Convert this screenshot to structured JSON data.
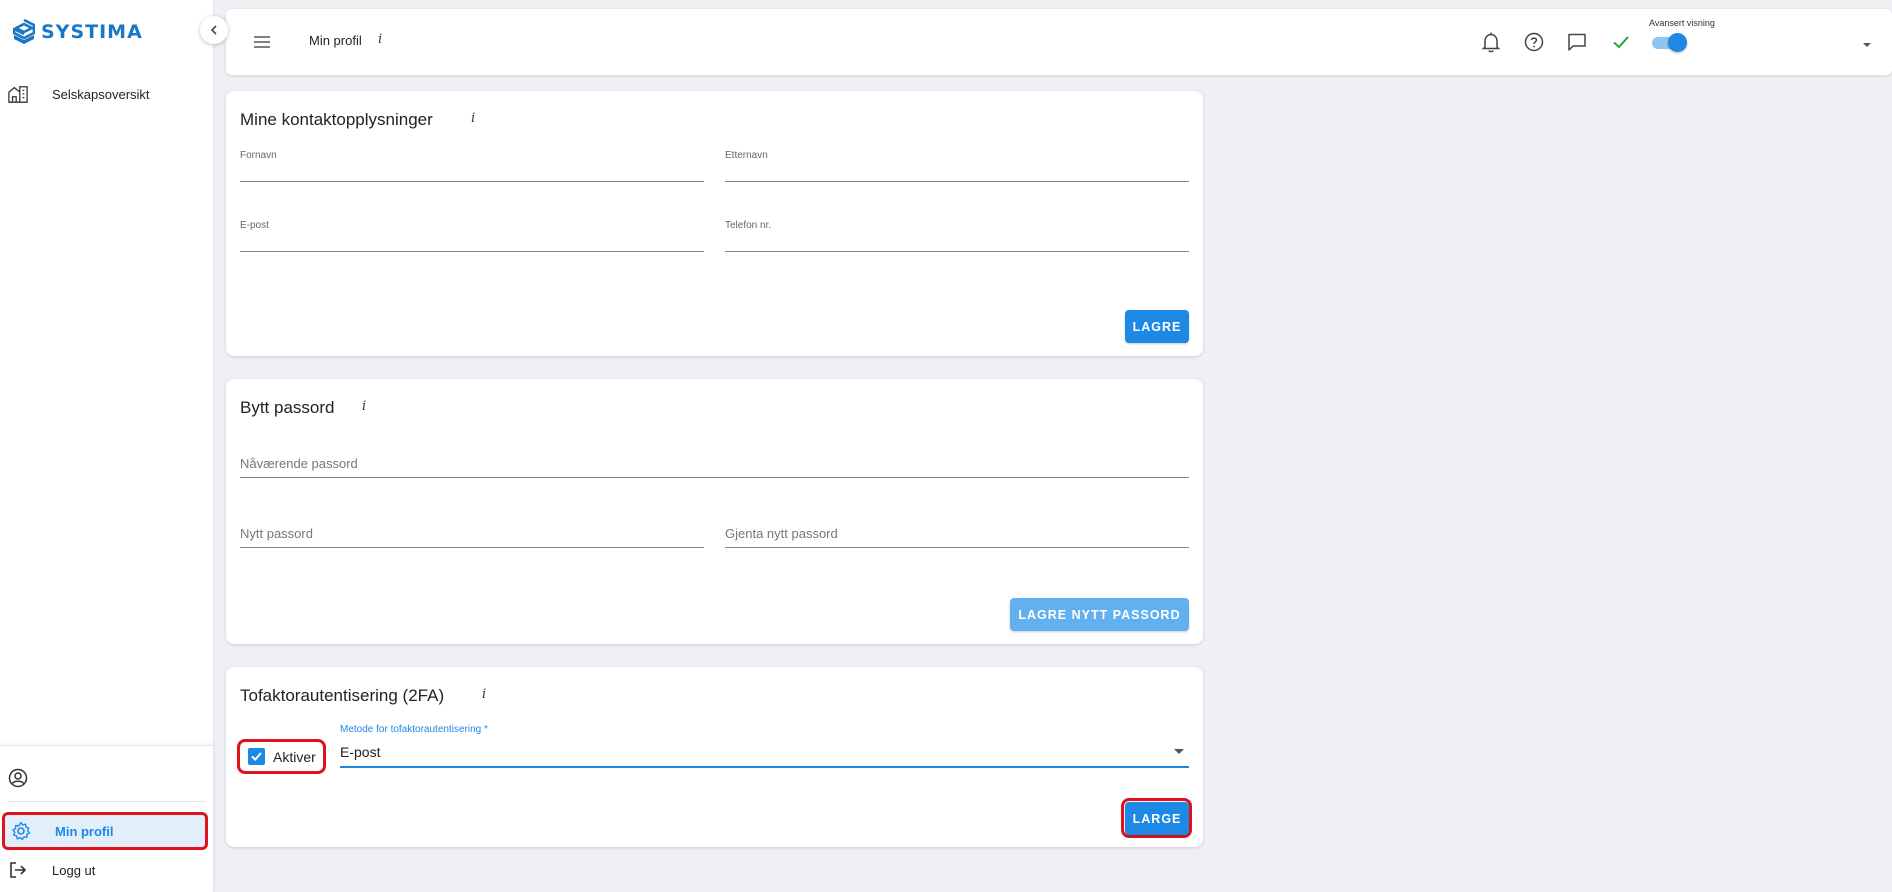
{
  "app": {
    "logo": "SYSTIMA"
  },
  "sidebar": {
    "items": [
      {
        "label": "Selskapsoversikt"
      },
      {
        "label": "Min profil"
      },
      {
        "label": "Logg ut"
      }
    ]
  },
  "header": {
    "title": "Min profil",
    "info": "i",
    "advanced_view_label": "Avansert visning",
    "advanced_view_on": true
  },
  "contact": {
    "title": "Mine kontaktopplysninger",
    "info": "i",
    "first_name_label": "Fornavn",
    "first_name_value": "",
    "last_name_label": "Etternavn",
    "last_name_value": "",
    "email_label": "E-post",
    "email_value": "",
    "phone_label": "Telefon nr.",
    "phone_value": "",
    "save_label": "LAGRE"
  },
  "password": {
    "title": "Bytt passord",
    "info": "i",
    "current_placeholder": "Nåværende passord",
    "new_placeholder": "Nytt passord",
    "repeat_placeholder": "Gjenta nytt passord",
    "save_label": "LAGRE NYTT PASSORD"
  },
  "twofa": {
    "title": "Tofaktorautentisering (2FA)",
    "info": "i",
    "activate_label": "Aktiver",
    "activated": true,
    "method_label": "Metode for tofaktorautentisering *",
    "method_value": "E-post",
    "save_label": "LARGE"
  },
  "colors": {
    "accent": "#1e88e5",
    "highlight": "#e0121c",
    "success": "#2e9e3e"
  }
}
